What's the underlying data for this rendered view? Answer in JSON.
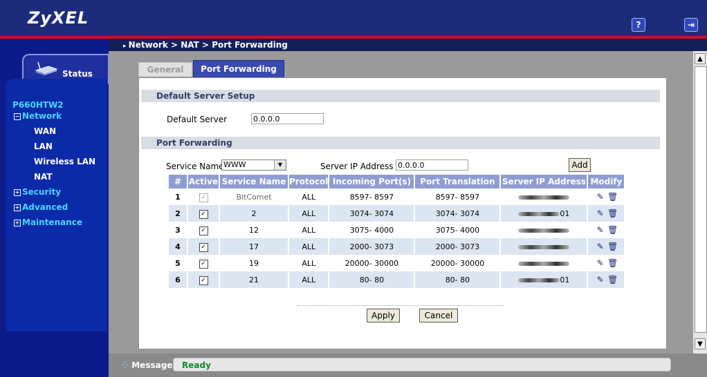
{
  "brand": "ZyXEL",
  "header": {
    "help_icon": "question-icon",
    "logout_icon": "logout-icon"
  },
  "breadcrumb": "Network > NAT > Port Forwarding",
  "sidebar": {
    "status_tab": "Status",
    "model": "P660HTW2",
    "network": "Network",
    "network_items": [
      "WAN",
      "LAN",
      "Wireless LAN",
      "NAT"
    ],
    "security": "Security",
    "advanced": "Advanced",
    "maintenance": "Maintenance"
  },
  "tabs": {
    "general": "General",
    "port_forwarding": "Port Forwarding"
  },
  "default_server": {
    "section_title": "Default Server Setup",
    "label": "Default Server",
    "value": "0.0.0.0"
  },
  "port_forwarding": {
    "section_title": "Port Forwarding",
    "service_name_label": "Service Name",
    "service_name_value": "WWW",
    "server_ip_label": "Server IP Address",
    "server_ip_value": "0.0.0.0",
    "add_label": "Add"
  },
  "table": {
    "headers": [
      "#",
      "Active",
      "Service Name",
      "Protocol",
      "Incoming Port(s)",
      "Port Translation",
      "Server IP Address",
      "Modify"
    ],
    "rows": [
      {
        "num": "1",
        "name": "BitComet",
        "protocol": "ALL",
        "incoming": "8597- 8597",
        "translation": "8597- 8597",
        "ip": "",
        "active_disabled": true
      },
      {
        "num": "2",
        "name": "2",
        "protocol": "ALL",
        "incoming": "3074- 3074",
        "translation": "3074- 3074",
        "ip": "01"
      },
      {
        "num": "3",
        "name": "12",
        "protocol": "ALL",
        "incoming": "3075- 4000",
        "translation": "3075- 4000",
        "ip": ""
      },
      {
        "num": "4",
        "name": "17",
        "protocol": "ALL",
        "incoming": "2000- 3073",
        "translation": "2000- 3073",
        "ip": ""
      },
      {
        "num": "5",
        "name": "19",
        "protocol": "ALL",
        "incoming": "20000- 30000",
        "translation": "20000- 30000",
        "ip": ""
      },
      {
        "num": "6",
        "name": "21",
        "protocol": "ALL",
        "incoming": "80- 80",
        "translation": "80- 80",
        "ip": "01"
      }
    ]
  },
  "actions": {
    "apply": "Apply",
    "cancel": "Cancel"
  },
  "message": {
    "label": "Message",
    "value": "Ready"
  }
}
